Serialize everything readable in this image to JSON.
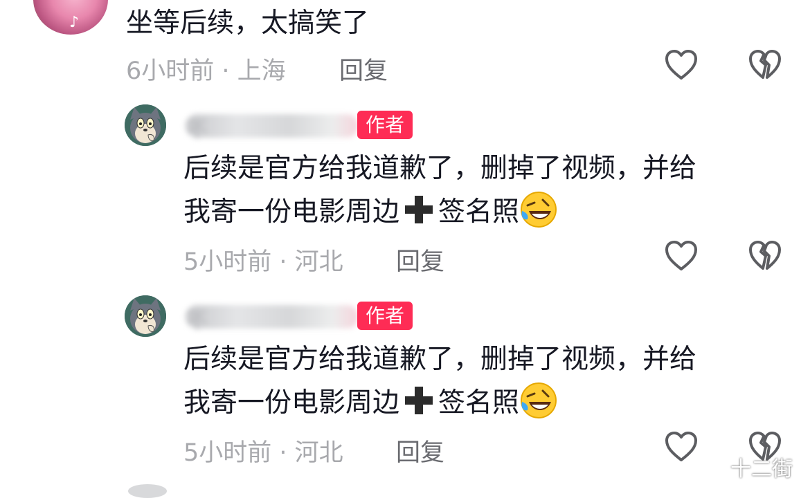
{
  "comments": [
    {
      "text": "坐等后续，太搞笑了",
      "time": "6小时前",
      "location": "上海",
      "reply": "回复"
    }
  ],
  "replies": [
    {
      "username": "不",
      "badge": "作者",
      "line1": "后续是官方给我道歉了，删掉了视频，并给",
      "line2a": "我寄一份电影周边",
      "line2b": "签名照",
      "time": "5小时前",
      "location": "河北",
      "reply": "回复"
    },
    {
      "username": "不",
      "badge": "作者",
      "line1": "后续是官方给我道歉了，删掉了视频，并给",
      "line2a": "我寄一份电影周边",
      "line2b": "签名照",
      "time": "5小时前",
      "location": "河北",
      "reply": "回复"
    }
  ],
  "icons": {
    "like": "heart-outline-icon",
    "dislike": "broken-heart-icon",
    "plus": "heavy-plus-emoji",
    "laugh": "rolling-laughing-emoji"
  },
  "colors": {
    "badge": "#fe2c55",
    "meta": "#a8a9ad",
    "reply": "#6a6b70",
    "icon": "#5c5d61"
  },
  "watermark": "十二街"
}
